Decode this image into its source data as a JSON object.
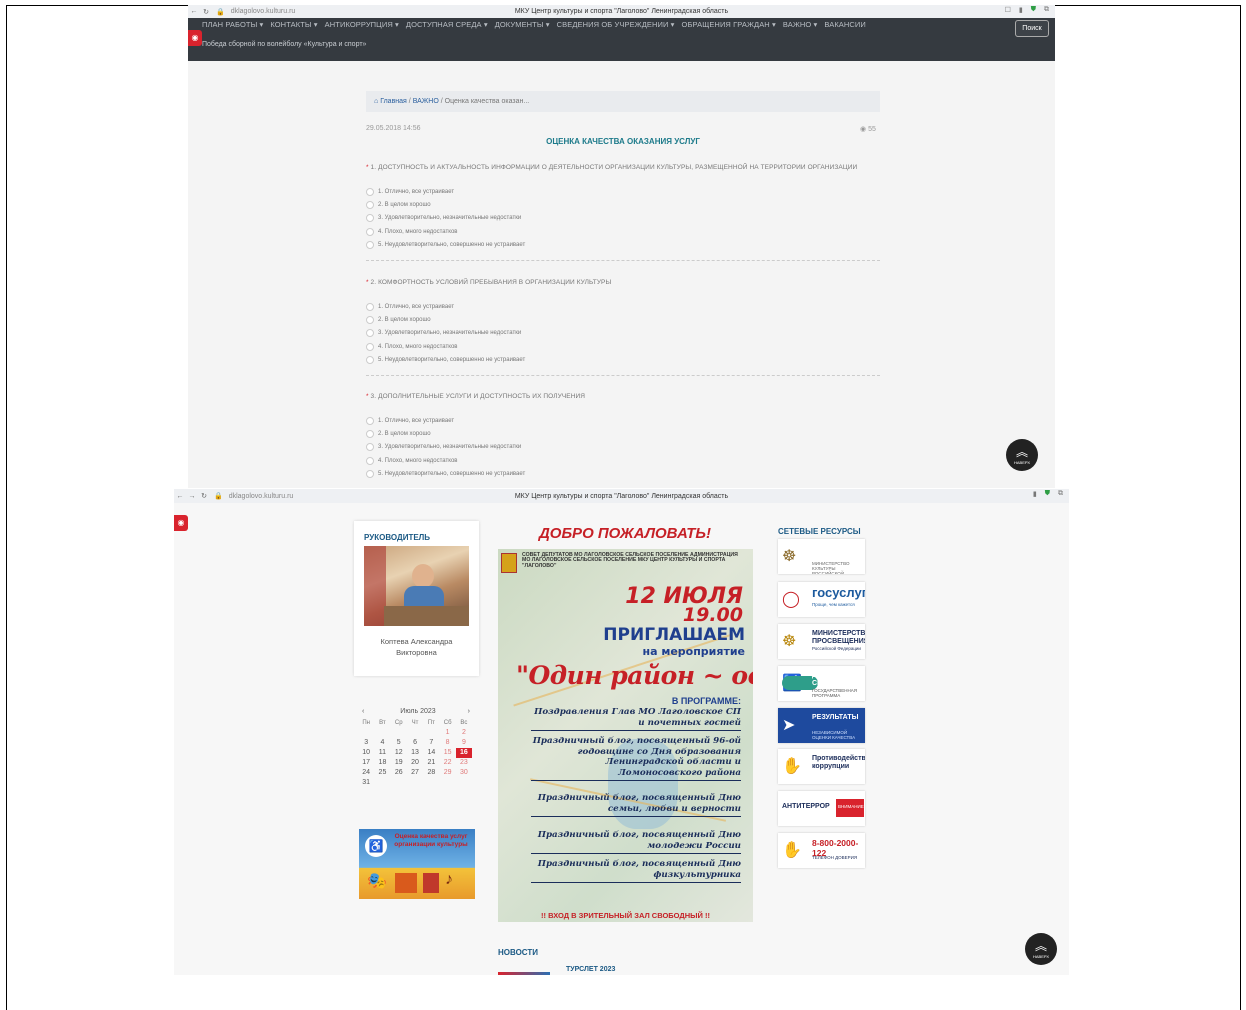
{
  "shot1": {
    "url": "dklagolovo.kulturu.ru",
    "tab_title": "МКУ Центр культуры и спорта \"Лаголово\" Ленинградская область",
    "menu": [
      "ПЛАН РАБОТЫ ▾",
      "КОНТАКТЫ ▾",
      "АНТИКОРРУПЦИЯ ▾",
      "ДОСТУПНАЯ СРЕДА ▾",
      "ДОКУМЕНТЫ ▾",
      "СВЕДЕНИЯ ОБ УЧРЕЖДЕНИИ ▾",
      "ОБРАЩЕНИЯ ГРАЖДАН ▾",
      "ВАЖНО ▾",
      "ВАКАНСИИ"
    ],
    "ticker": "Победа сборной по волейболу «Культура и спорт»",
    "search_label": "Поиск",
    "breadcrumb": {
      "home": "Главная",
      "sep": "/",
      "section": "ВАЖНО",
      "current": "Оценка качества оказан..."
    },
    "date": "29.05.2018 14:56",
    "views": "55",
    "heading": "ОЦЕНКА КАЧЕСТВА ОКАЗАНИЯ УСЛУГ",
    "questions": [
      {
        "title": "1. ДОСТУПНОСТЬ И АКТУАЛЬНОСТЬ ИНФОРМАЦИИ О ДЕЯТЕЛЬНОСТИ ОРГАНИЗАЦИИ КУЛЬТУРЫ, РАЗМЕЩЕННОЙ НА ТЕРРИТОРИИ ОРГАНИЗАЦИИ",
        "options": [
          "1. Отлично, все устраивает",
          "2. В целом хорошо",
          "3. Удовлетворительно, незначительные недостатки",
          "4. Плохо, много недостатков",
          "5. Неудовлетворительно, совершенно не устраивает"
        ]
      },
      {
        "title": "2. КОМФОРТНОСТЬ УСЛОВИЙ ПРЕБЫВАНИЯ В ОРГАНИЗАЦИИ КУЛЬТУРЫ",
        "options": [
          "1. Отлично, все устраивает",
          "2. В целом хорошо",
          "3. Удовлетворительно, незначительные недостатки",
          "4. Плохо, много недостатков",
          "5. Неудовлетворительно, совершенно не устраивает"
        ]
      },
      {
        "title": "3. ДОПОЛНИТЕЛЬНЫЕ УСЛУГИ И ДОСТУПНОСТЬ ИХ ПОЛУЧЕНИЯ",
        "options": [
          "1. Отлично, все устраивает",
          "2. В целом хорошо",
          "3. Удовлетворительно, незначительные недостатки",
          "4. Плохо, много недостатков",
          "5. Неудовлетворительно, совершенно не устраивает"
        ]
      }
    ],
    "up_label": "НАВЕРХ"
  },
  "shot2": {
    "url": "dklagolovo.kulturu.ru",
    "tab_title": "МКУ Центр культуры и спорта \"Лаголово\" Ленинградская область",
    "director_title": "РУКОВОДИТЕЛЬ",
    "director_name": "Коптева Александра Викторовна",
    "calendar": {
      "month": "Июль 2023",
      "weekdays": [
        "Пн",
        "Вт",
        "Ср",
        "Чт",
        "Пт",
        "Сб",
        "Вс"
      ],
      "days": [
        "",
        "",
        "",
        "",
        "",
        "1",
        "2",
        "3",
        "4",
        "5",
        "6",
        "7",
        "8",
        "9",
        "10",
        "11",
        "12",
        "13",
        "14",
        "15",
        "16",
        "17",
        "18",
        "19",
        "20",
        "21",
        "22",
        "23",
        "24",
        "25",
        "26",
        "27",
        "28",
        "29",
        "30",
        "31"
      ],
      "today": "16"
    },
    "banner_text": "Оценка качества услуг организации культуры",
    "welcome": "ДОБРО ПОЖАЛОВАТЬ!",
    "poster": {
      "org": "СОВЕТ ДЕПУТАТОВ МО ЛАГОЛОВСКОЕ СЕЛЬСКОЕ ПОСЕЛЕНИЕ АДМИНИСТРАЦИЯ МО ЛАГОЛОВСКОЕ СЕЛЬСКОЕ ПОСЕЛЕНИЕ МКУ ЦЕНТР КУЛЬТУРЫ И СПОРТА \"ЛАГОЛОВО\"",
      "date": "12 ИЮЛЯ",
      "time": "19.00",
      "invite1": "ПРИГЛАШАЕМ",
      "invite2": "на мероприятие",
      "motto": "\"Один район ~ одна семья\"",
      "program": "В ПРОГРАММЕ:",
      "items": [
        "Поздравления Глав МО Лаголовское СП и почетных гостей",
        "Праздничный блог, посвященный 96-ой годовщине со Дня образования Ленинградской области и Ломоносовского района",
        "Праздничный блог, посвященный Дню семьи, любви и верности",
        "Праздничный блог, посвященный Дню молодежи России",
        "Праздничный блог, посвященный Дню физкультурника"
      ],
      "free": "!! ВХОД В ЗРИТЕЛЬНЫЙ ЗАЛ СВОБОДНЫЙ !!"
    },
    "resources_title": "СЕТЕВЫЕ РЕСУРСЫ",
    "resources": [
      {
        "main": "",
        "sub": "МИНИСТЕРСТВО КУЛЬТУРЫ РОССИЙСКОЙ ФЕДЕРАЦИИ"
      },
      {
        "main": "госуслуги",
        "sub": "Проще, чем кажется"
      },
      {
        "main": "МИНИСТЕРСТВО ПРОСВЕЩЕНИЯ",
        "sub": "Российской Федерации"
      },
      {
        "main": "ДОСТУПНАЯ СРЕДА",
        "sub": "ГОСУДАРСТВЕННАЯ ПРОГРАММА"
      },
      {
        "main": "РЕЗУЛЬТАТЫ",
        "sub": "НЕЗАВИСИМОЙ ОЦЕНКИ КАЧЕСТВА"
      },
      {
        "main": "Противодействие коррупции",
        "sub": ""
      },
      {
        "main": "АНТИТЕРРОР",
        "sub": "ВНИМАНИЕ!"
      },
      {
        "main": "8-800-2000-122",
        "sub": "ТЕЛЕФОН ДОВЕРИЯ"
      }
    ],
    "news_title": "НОВОСТИ",
    "news_item": "ТУРСЛЕТ 2023",
    "up_label": "НАВЕРХ"
  },
  "colors": {
    "accent_red": "#d9232d",
    "heading_teal": "#1c7a8a",
    "nav_dark": "#353a40",
    "link_blue": "#1c5a85"
  }
}
